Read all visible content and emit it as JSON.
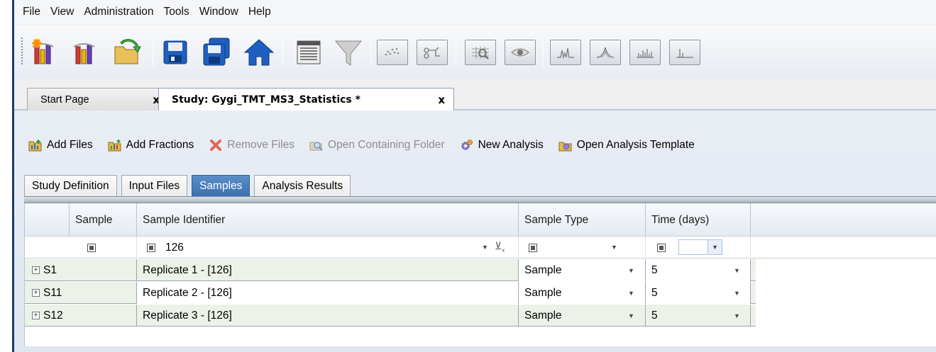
{
  "menu": [
    "File",
    "View",
    "Administration",
    "Tools",
    "Window",
    "Help"
  ],
  "toolbar_icons": [
    "new-study-icon",
    "open-study-icon",
    "open-folder-icon",
    "save-icon",
    "save-all-icon",
    "home-icon",
    "table-view-icon",
    "filter-funnel-icon",
    "scatter-plot-icon",
    "workflow-icon",
    "zoom-view-icon",
    "eye-view-icon",
    "spectrum-icon",
    "peak-icon",
    "histogram-icon",
    "bar-plot-icon"
  ],
  "doc_tabs": {
    "start": "Start Page",
    "study": "Study: Gygi_TMT_MS3_Statistics *",
    "close": "x"
  },
  "actions": {
    "add_files": "Add Files",
    "add_fractions": "Add Fractions",
    "remove_files": "Remove Files",
    "open_folder": "Open Containing Folder",
    "new_analysis": "New Analysis",
    "open_template": "Open Analysis Template"
  },
  "subtabs": {
    "study_definition": "Study Definition",
    "input_files": "Input Files",
    "samples": "Samples",
    "analysis_results": "Analysis Results"
  },
  "grid": {
    "headers": {
      "sample": "Sample",
      "identifier": "Sample Identifier",
      "type": "Sample Type",
      "time": "Time (days)"
    },
    "filter_identifier": "126",
    "rows": [
      {
        "sample": "S1",
        "identifier": "Replicate 1 - [126]",
        "type": "Sample",
        "time": "5"
      },
      {
        "sample": "S11",
        "identifier": "Replicate 2 - [126]",
        "type": "Sample",
        "time": "5"
      },
      {
        "sample": "S12",
        "identifier": "Replicate 3 - [126]",
        "type": "Sample",
        "time": "5"
      }
    ]
  },
  "colors": {
    "active_tab": "#3b6fb0",
    "row_bg": "#ecf2e8",
    "frame": "#1e3a6e"
  }
}
